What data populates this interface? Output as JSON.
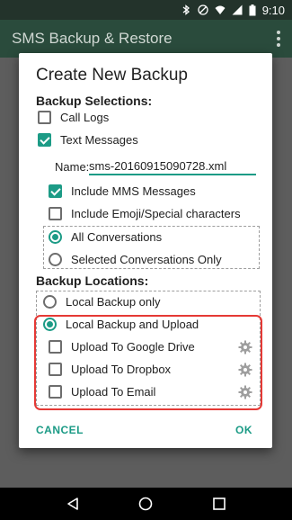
{
  "status": {
    "time": "9:10"
  },
  "app": {
    "title": "SMS Backup & Restore"
  },
  "dialog": {
    "title": "Create New Backup",
    "selections_heading": "Backup Selections:",
    "call_logs": {
      "label": "Call Logs",
      "checked": false
    },
    "text_messages": {
      "label": "Text Messages",
      "checked": true
    },
    "name_label": "Name:",
    "name_value": "sms-20160915090728.xml",
    "include_mms": {
      "label": "Include MMS Messages",
      "checked": true
    },
    "include_emoji": {
      "label": "Include Emoji/Special characters",
      "checked": false
    },
    "all_conversations": {
      "label": "All Conversations",
      "selected": true
    },
    "selected_conversations": {
      "label": "Selected Conversations Only",
      "selected": false
    },
    "locations_heading": "Backup Locations:",
    "local_only": {
      "label": "Local Backup only",
      "selected": false
    },
    "local_upload": {
      "label": "Local Backup and Upload",
      "selected": true
    },
    "upload_drive": {
      "label": "Upload To Google Drive",
      "checked": false
    },
    "upload_dropbox": {
      "label": "Upload To Dropbox",
      "checked": false
    },
    "upload_email": {
      "label": "Upload To Email",
      "checked": false
    },
    "cancel_label": "CANCEL",
    "ok_label": "OK"
  },
  "colors": {
    "accent": "#1c9b86",
    "appbar": "#2a4b3c",
    "highlight": "#e53935"
  }
}
